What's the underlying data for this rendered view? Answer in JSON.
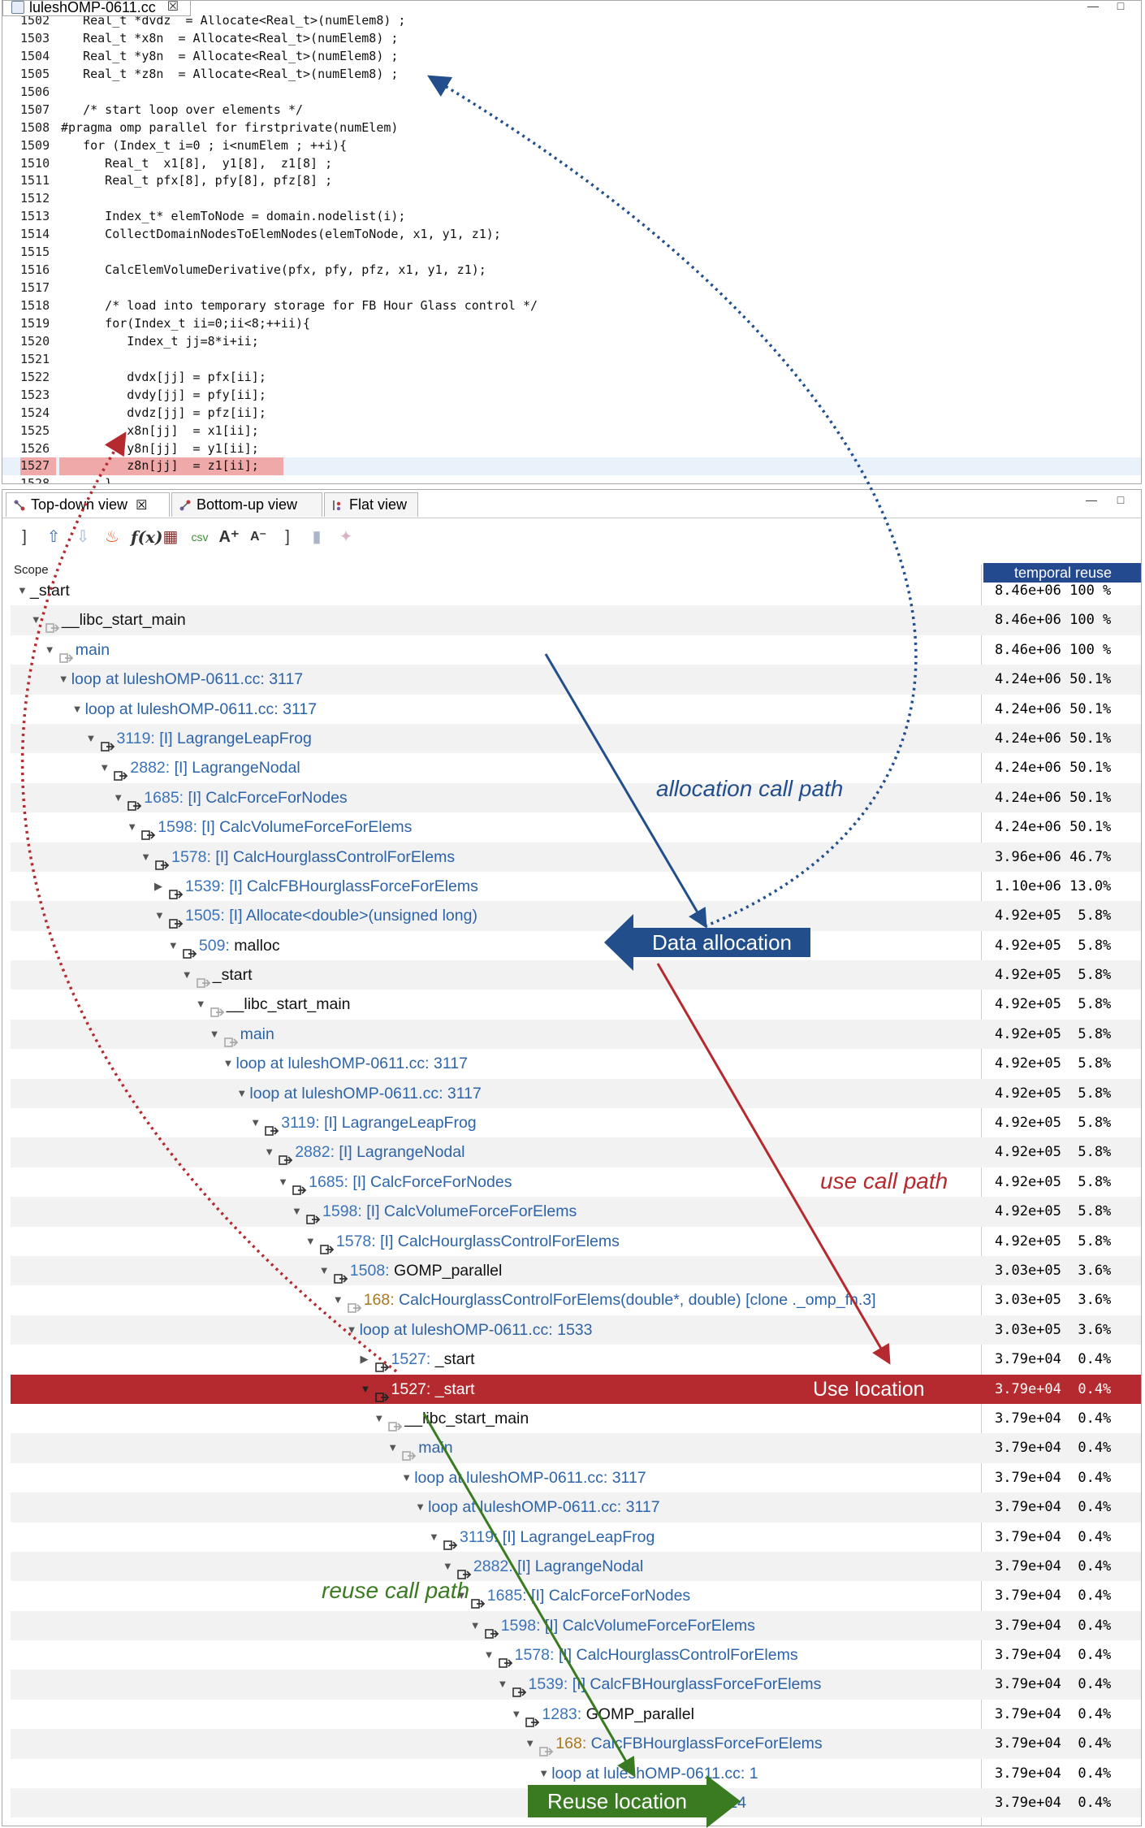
{
  "editor": {
    "tab_title": "luleshOMP-0611.cc",
    "tab_close": "☒",
    "lines": [
      {
        "n": "1502",
        "code": "   Real_t *dvdz  = Allocate<Real_t>(numElem8) ;"
      },
      {
        "n": "1503",
        "code": "   Real_t *x8n  = Allocate<Real_t>(numElem8) ;"
      },
      {
        "n": "1504",
        "code": "   Real_t *y8n  = Allocate<Real_t>(numElem8) ;"
      },
      {
        "n": "1505",
        "code": "   Real_t *z8n  = Allocate<Real_t>(numElem8) ;"
      },
      {
        "n": "1506",
        "code": ""
      },
      {
        "n": "1507",
        "code": "   /* start loop over elements */"
      },
      {
        "n": "1508",
        "code": "#pragma omp parallel for firstprivate(numElem)"
      },
      {
        "n": "1509",
        "code": "   for (Index_t i=0 ; i<numElem ; ++i){"
      },
      {
        "n": "1510",
        "code": "      Real_t  x1[8],  y1[8],  z1[8] ;"
      },
      {
        "n": "1511",
        "code": "      Real_t pfx[8], pfy[8], pfz[8] ;"
      },
      {
        "n": "1512",
        "code": ""
      },
      {
        "n": "1513",
        "code": "      Index_t* elemToNode = domain.nodelist(i);"
      },
      {
        "n": "1514",
        "code": "      CollectDomainNodesToElemNodes(elemToNode, x1, y1, z1);"
      },
      {
        "n": "1515",
        "code": ""
      },
      {
        "n": "1516",
        "code": "      CalcElemVolumeDerivative(pfx, pfy, pfz, x1, y1, z1);"
      },
      {
        "n": "1517",
        "code": ""
      },
      {
        "n": "1518",
        "code": "      /* load into temporary storage for FB Hour Glass control */"
      },
      {
        "n": "1519",
        "code": "      for(Index_t ii=0;ii<8;++ii){"
      },
      {
        "n": "1520",
        "code": "         Index_t jj=8*i+ii;"
      },
      {
        "n": "1521",
        "code": ""
      },
      {
        "n": "1522",
        "code": "         dvdx[jj] = pfx[ii];"
      },
      {
        "n": "1523",
        "code": "         dvdy[jj] = pfy[ii];"
      },
      {
        "n": "1524",
        "code": "         dvdz[jj] = pfz[ii];"
      },
      {
        "n": "1525",
        "code": "         x8n[jj]  = x1[ii];"
      },
      {
        "n": "1526",
        "code": "         y8n[jj]  = y1[ii];"
      },
      {
        "n": "1527",
        "code": "         z8n[jj]  = z1[ii];"
      },
      {
        "n": "1528",
        "code": "      }"
      }
    ]
  },
  "views": {
    "tabs": [
      "Top-down view",
      "Bottom-up view",
      "Flat view"
    ],
    "active_close": "☒"
  },
  "tree": {
    "scope_header": "Scope",
    "metric_header": "temporal reuse",
    "rows": [
      {
        "d": 0,
        "t": "▼",
        "i": "",
        "num": "",
        "name": "_start",
        "c": "dark",
        "v": "8.46e+06 100 %"
      },
      {
        "d": 1,
        "t": "▼",
        "i": "g",
        "num": "",
        "name": "__libc_start_main",
        "c": "dark",
        "v": "8.46e+06 100 %"
      },
      {
        "d": 2,
        "t": "▼",
        "i": "g",
        "num": "",
        "name": "main",
        "c": "blue",
        "v": "8.46e+06 100 %"
      },
      {
        "d": 3,
        "t": "▼",
        "i": "",
        "num": "",
        "name": "loop at luleshOMP-0611.cc: 3117",
        "c": "blue",
        "v": "4.24e+06 50.1%"
      },
      {
        "d": 4,
        "t": "▼",
        "i": "",
        "num": "",
        "name": "loop at luleshOMP-0611.cc: 3117",
        "c": "blue",
        "v": "4.24e+06 50.1%"
      },
      {
        "d": 5,
        "t": "▼",
        "i": "c",
        "num": "3119:",
        "name": " [I] LagrangeLeapFrog",
        "c": "blue",
        "v": "4.24e+06 50.1%"
      },
      {
        "d": 6,
        "t": "▼",
        "i": "c",
        "num": "2882:",
        "name": " [I] LagrangeNodal",
        "c": "blue",
        "v": "4.24e+06 50.1%"
      },
      {
        "d": 7,
        "t": "▼",
        "i": "c",
        "num": "1685:",
        "name": " [I] CalcForceForNodes",
        "c": "blue",
        "v": "4.24e+06 50.1%"
      },
      {
        "d": 8,
        "t": "▼",
        "i": "c",
        "num": "1598:",
        "name": " [I] CalcVolumeForceForElems",
        "c": "blue",
        "v": "4.24e+06 50.1%"
      },
      {
        "d": 9,
        "t": "▼",
        "i": "c",
        "num": "1578:",
        "name": " [I] CalcHourglassControlForElems",
        "c": "blue",
        "v": "3.96e+06 46.7%"
      },
      {
        "d": 10,
        "t": "▶",
        "i": "c",
        "num": "1539:",
        "name": " [I] CalcFBHourglassForceForElems",
        "c": "blue",
        "v": "1.10e+06 13.0%"
      },
      {
        "d": 10,
        "t": "▼",
        "i": "c",
        "num": "1505:",
        "name": " [I] Allocate<double>(unsigned long)",
        "c": "blue",
        "v": "4.92e+05  5.8%"
      },
      {
        "d": 11,
        "t": "▼",
        "i": "c",
        "num": "509:",
        "name": " malloc",
        "c": "dark",
        "v": "4.92e+05  5.8%"
      },
      {
        "d": 12,
        "t": "▼",
        "i": "g",
        "num": "",
        "name": "_start",
        "c": "dark",
        "v": "4.92e+05  5.8%"
      },
      {
        "d": 13,
        "t": "▼",
        "i": "g",
        "num": "",
        "name": "__libc_start_main",
        "c": "dark",
        "v": "4.92e+05  5.8%"
      },
      {
        "d": 14,
        "t": "▼",
        "i": "g",
        "num": "",
        "name": "main",
        "c": "blue",
        "v": "4.92e+05  5.8%"
      },
      {
        "d": 15,
        "t": "▼",
        "i": "",
        "num": "",
        "name": "loop at luleshOMP-0611.cc: 3117",
        "c": "blue",
        "v": "4.92e+05  5.8%"
      },
      {
        "d": 16,
        "t": "▼",
        "i": "",
        "num": "",
        "name": "loop at luleshOMP-0611.cc: 3117",
        "c": "blue",
        "v": "4.92e+05  5.8%"
      },
      {
        "d": 17,
        "t": "▼",
        "i": "c",
        "num": "3119:",
        "name": " [I] LagrangeLeapFrog",
        "c": "blue",
        "v": "4.92e+05  5.8%"
      },
      {
        "d": 18,
        "t": "▼",
        "i": "c",
        "num": "2882:",
        "name": " [I] LagrangeNodal",
        "c": "blue",
        "v": "4.92e+05  5.8%"
      },
      {
        "d": 19,
        "t": "▼",
        "i": "c",
        "num": "1685:",
        "name": " [I] CalcForceForNodes",
        "c": "blue",
        "v": "4.92e+05  5.8%"
      },
      {
        "d": 20,
        "t": "▼",
        "i": "c",
        "num": "1598:",
        "name": " [I] CalcVolumeForceForElems",
        "c": "blue",
        "v": "4.92e+05  5.8%"
      },
      {
        "d": 21,
        "t": "▼",
        "i": "c",
        "num": "1578:",
        "name": " [I] CalcHourglassControlForElems",
        "c": "blue",
        "v": "4.92e+05  5.8%"
      },
      {
        "d": 22,
        "t": "▼",
        "i": "c",
        "num": "1508:",
        "name": " GOMP_parallel",
        "c": "dark",
        "v": "3.03e+05  3.6%"
      },
      {
        "d": 23,
        "t": "▼",
        "i": "g",
        "num": "168:",
        "orange": true,
        "name": " CalcHourglassControlForElems(double*, double) [clone ._omp_fn.3]",
        "c": "blue",
        "v": "3.03e+05  3.6%"
      },
      {
        "d": 24,
        "t": "▼",
        "i": "",
        "num": "",
        "name": "loop at luleshOMP-0611.cc: 1533",
        "c": "blue",
        "v": "3.03e+05  3.6%"
      },
      {
        "d": 25,
        "t": "▶",
        "i": "c",
        "num": "1527:",
        "name": " _start",
        "c": "dark",
        "v": "3.79e+04  0.4%"
      },
      {
        "d": 25,
        "t": "▼",
        "i": "c",
        "num": "1527:",
        "name": " _start",
        "c": "dark",
        "v": "3.79e+04  0.4%",
        "sel": true
      },
      {
        "d": 26,
        "t": "▼",
        "i": "g",
        "num": "",
        "name": "__libc_start_main",
        "c": "dark",
        "v": "3.79e+04  0.4%"
      },
      {
        "d": 27,
        "t": "▼",
        "i": "g",
        "num": "",
        "name": "main",
        "c": "blue",
        "v": "3.79e+04  0.4%"
      },
      {
        "d": 28,
        "t": "▼",
        "i": "",
        "num": "",
        "name": "loop at luleshOMP-0611.cc: 3117",
        "c": "blue",
        "v": "3.79e+04  0.4%"
      },
      {
        "d": 29,
        "t": "▼",
        "i": "",
        "num": "",
        "name": "loop at luleshOMP-0611.cc: 3117",
        "c": "blue",
        "v": "3.79e+04  0.4%"
      },
      {
        "d": 30,
        "t": "▼",
        "i": "c",
        "num": "3119:",
        "name": " [I] LagrangeLeapFrog",
        "c": "blue",
        "v": "3.79e+04  0.4%"
      },
      {
        "d": 31,
        "t": "▼",
        "i": "c",
        "num": "2882:",
        "name": " [I] LagrangeNodal",
        "c": "blue",
        "v": "3.79e+04  0.4%"
      },
      {
        "d": 32,
        "t": "▼",
        "i": "c",
        "num": "1685:",
        "name": " [I] CalcForceForNodes",
        "c": "blue",
        "v": "3.79e+04  0.4%"
      },
      {
        "d": 33,
        "t": "▼",
        "i": "c",
        "num": "1598:",
        "name": " [I] CalcVolumeForceForElems",
        "c": "blue",
        "v": "3.79e+04  0.4%"
      },
      {
        "d": 34,
        "t": "▼",
        "i": "c",
        "num": "1578:",
        "name": " [I] CalcHourglassControlForElems",
        "c": "blue",
        "v": "3.79e+04  0.4%"
      },
      {
        "d": 35,
        "t": "▼",
        "i": "c",
        "num": "1539:",
        "name": " [I] CalcFBHourglassForceForElems",
        "c": "blue",
        "v": "3.79e+04  0.4%"
      },
      {
        "d": 36,
        "t": "▼",
        "i": "c",
        "num": "1283:",
        "name": " GOMP_parallel",
        "c": "dark",
        "v": "3.79e+04  0.4%"
      },
      {
        "d": 37,
        "t": "▼",
        "i": "g",
        "num": "168:",
        "orange": true,
        "name": " CalcFBHourglassForceForElems",
        "c": "blue",
        "v": "3.79e+04  0.4%"
      },
      {
        "d": 38,
        "t": "▼",
        "i": "",
        "num": "",
        "name": "loop at luleshOMP-0611.cc: 1",
        "c": "blue",
        "v": "3.79e+04  0.4%"
      },
      {
        "d": 39,
        "t": "",
        "i": "",
        "num": "",
        "name": "luleshOMP-0611.cc: 1314",
        "c": "blue",
        "v": "3.79e+04  0.4%"
      }
    ]
  },
  "annotations": {
    "allocation_call_path": "allocation call path",
    "data_allocation": "Data allocation",
    "use_call_path": "use call path",
    "use_location": "Use location",
    "reuse_call_path": "reuse call path",
    "reuse_location": "Reuse location",
    "colors": {
      "blue": "#224f8c",
      "red": "#b42a2f",
      "green": "#3a7b22"
    }
  }
}
